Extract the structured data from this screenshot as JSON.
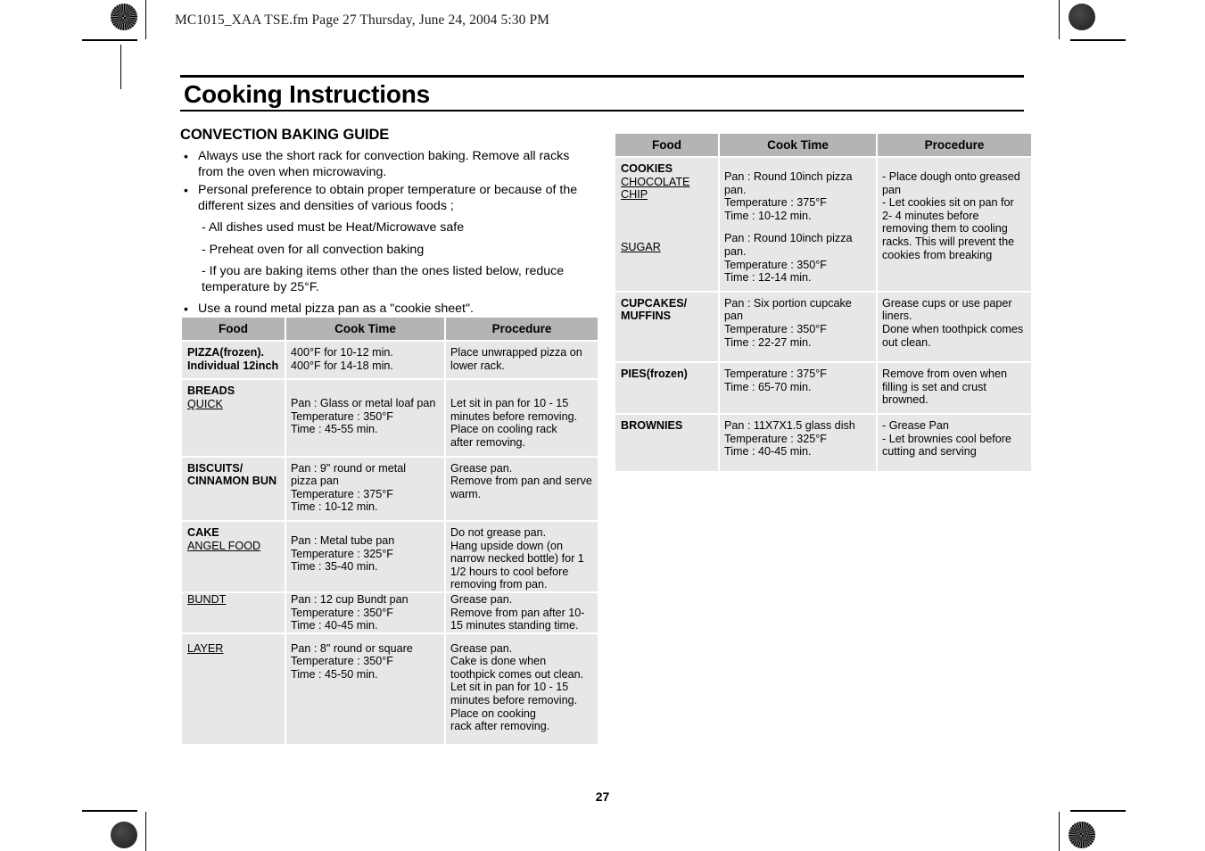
{
  "header": {
    "file_line": "MC1015_XAA TSE.fm  Page 27  Thursday, June 24, 2004  5:30 PM"
  },
  "title": "Cooking Instructions",
  "section": {
    "heading": "CONVECTION BAKING GUIDE",
    "bullets": [
      "Always use the short rack for convection baking. Remove all racks from the oven when microwaving.",
      "Personal preference to obtain proper temperature or because of the different sizes and densities of various foods ;"
    ],
    "sub_items": [
      "- All dishes used must be Heat/Microwave safe",
      "- Preheat oven for all convection baking",
      "- If you are baking items other than the ones listed below, reduce temperature by 25°F."
    ],
    "final_bullet": "Use a round metal pizza pan as a \"cookie sheet\"."
  },
  "table_left": {
    "columns": [
      "Food",
      "Cook Time",
      "Procedure"
    ],
    "rows": [
      {
        "food_main": "PIZZA(frozen).",
        "food_sub2": "Individual 12inch",
        "food_underlined": "",
        "food_underlined2": "",
        "cook_time": "400°F for 10-12 min.\n400°F for 14-18 min.",
        "procedure": "Place unwrapped pizza on\nlower rack."
      },
      {
        "food_main": "BREADS",
        "food_underlined": "QUICK",
        "cook_time": "Pan : Glass or metal loaf pan\nTemperature : 350°F\nTime : 45-55 min.",
        "procedure": "Let sit in pan for 10 - 15\nminutes before removing.\nPlace on cooling rack\nafter removing."
      },
      {
        "food_main": "BISCUITS/",
        "food_sub2": "CINNAMON BUN",
        "food_underlined": "",
        "cook_time": "Pan : 9\"  round or metal\npizza pan\nTemperature : 375°F\nTime : 10-12 min.",
        "procedure": "Grease pan.\nRemove from pan and serve\nwarm."
      },
      {
        "food_main": "CAKE",
        "food_underlined": "ANGEL FOOD",
        "cook_time": "Pan : Metal tube pan\nTemperature : 325°F\nTime : 35-40 min.",
        "procedure": "Do not grease pan.\nHang upside down (on\nnarrow necked bottle) for 1\n1/2 hours to cool before\nremoving from pan."
      },
      {
        "food_main": "",
        "food_underlined": "BUNDT",
        "cook_time": "Pan : 12 cup Bundt pan\nTemperature : 350°F\nTime : 40-45 min.",
        "procedure": "Grease pan.\nRemove from pan after 10-\n15 minutes standing time."
      },
      {
        "food_main": "",
        "food_underlined": "LAYER",
        "cook_time": "Pan : 8\" round or square\nTemperature : 350°F\nTime : 45-50 min.",
        "procedure": "Grease pan.\nCake is done when\ntoothpick comes out clean.\nLet sit in pan for 10 - 15\nminutes before removing.\nPlace on cooking\nrack after removing."
      }
    ]
  },
  "table_right": {
    "columns": [
      "Food",
      "Cook Time",
      "Procedure"
    ],
    "rows": [
      {
        "food_main": "COOKIES",
        "food_underlined": "CHOCOLATE ",
        "food_underlined2": "CHIP",
        "food_underlined3": "SUGAR",
        "cook_time": "Pan : Round 10inch pizza\npan.\nTemperature : 375°F\nTime : 10-12 min.",
        "cook_time2": "Pan : Round 10inch pizza\npan.\nTemperature : 350°F\nTime : 12-14 min.",
        "procedure": "- Place dough onto greased\n   pan\n- Let cookies sit on pan for\n   2- 4 minutes before\n   removing them to cooling\n   racks. This will prevent the\n   cookies from breaking"
      },
      {
        "food_main": "CUPCAKES/",
        "food_sub2": "MUFFINS",
        "cook_time": "Pan : Six portion cupcake\npan\nTemperature : 350°F\nTime : 22-27 min.",
        "procedure": "Grease cups or use paper\nliners.\nDone when toothpick comes\nout clean."
      },
      {
        "food_main": "PIES(frozen)",
        "cook_time": "Temperature : 375°F\nTime : 65-70 min.",
        "procedure": "Remove from oven when\nfilling is set and crust\nbrowned."
      },
      {
        "food_main": "BROWNIES",
        "cook_time": "Pan : 11X7X1.5 glass dish\nTemperature : 325°F\nTime : 40-45 min.",
        "procedure": "- Grease Pan\n- Let brownies cool before\n   cutting and serving"
      }
    ]
  },
  "page_number": "27",
  "colors": {
    "header_gray": "#b4b4b4",
    "cell_gray": "#e7e7e7",
    "text": "#000000"
  }
}
